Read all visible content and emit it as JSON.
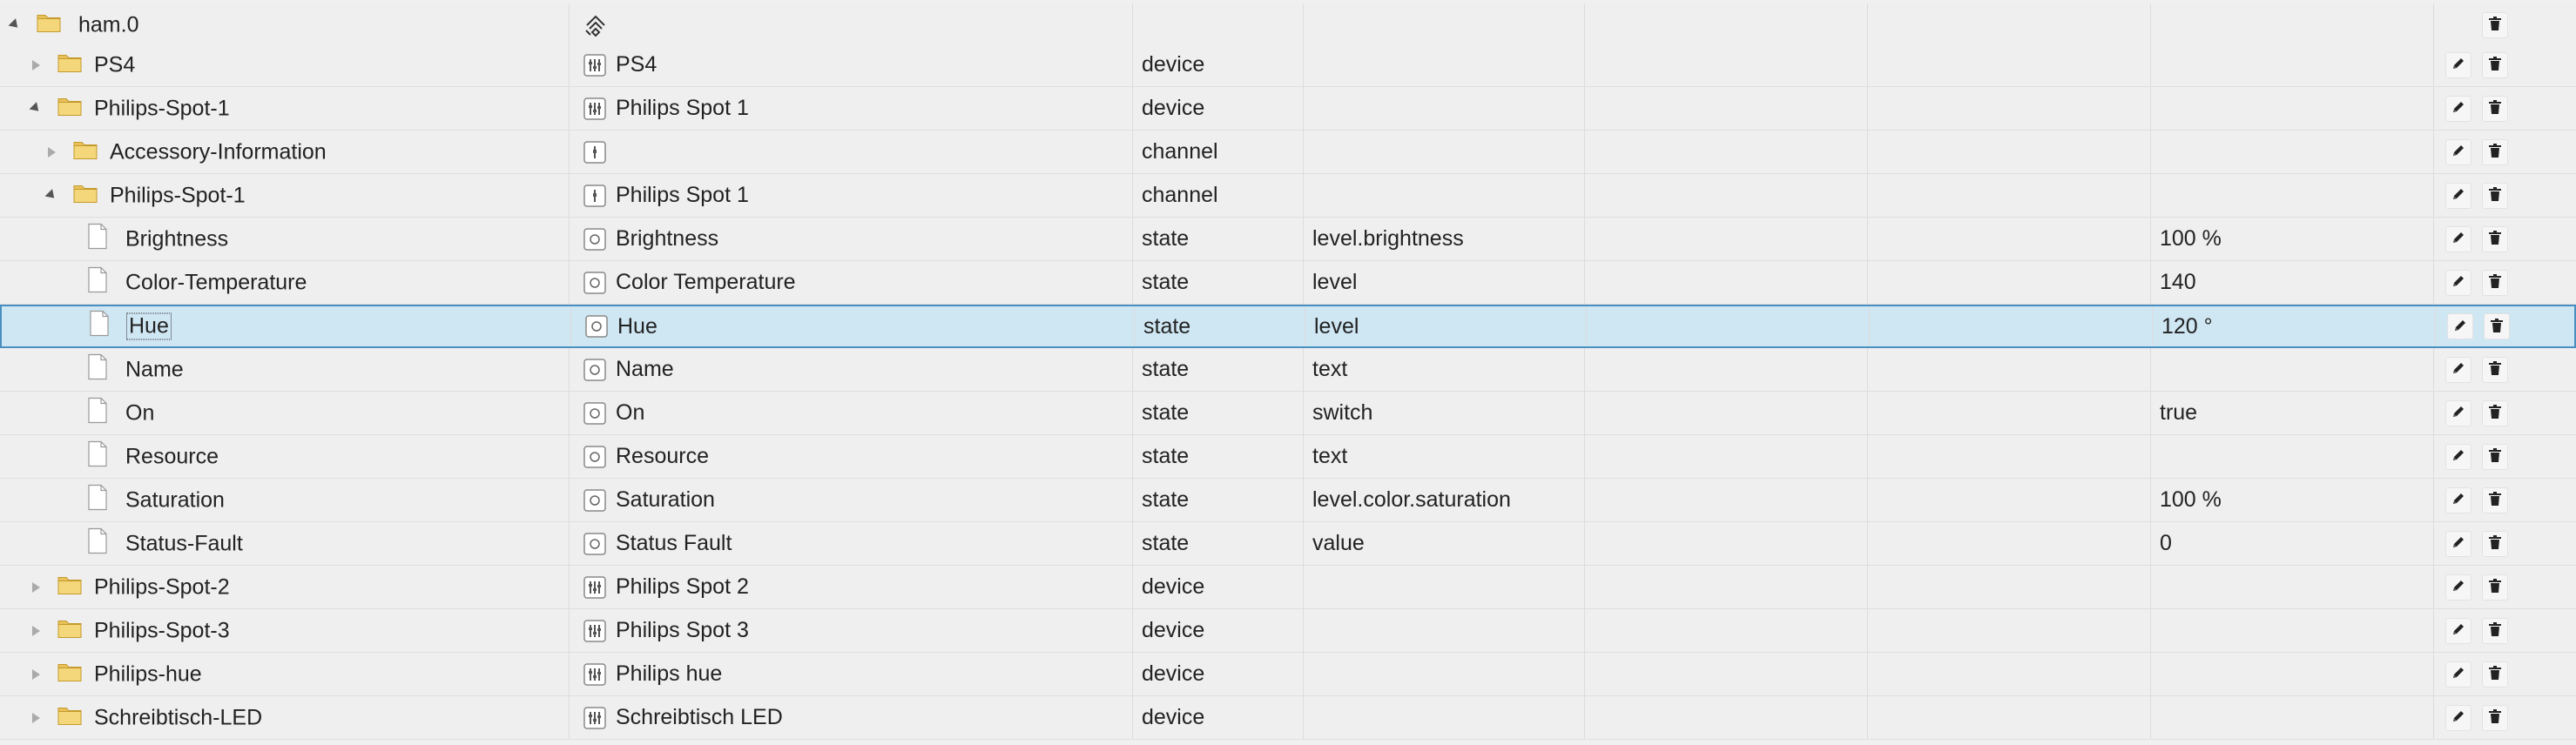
{
  "rows": [
    {
      "name": "ham.0",
      "level": 0,
      "expander": "expanded",
      "kind": "folder",
      "type_icon": "instance-icon",
      "display_name": "",
      "type": "",
      "role": "",
      "value": "",
      "editable": false,
      "selected": false
    },
    {
      "name": "PS4",
      "level": 1,
      "expander": "collapsed",
      "kind": "folder",
      "type_icon": "device-icon",
      "display_name": "PS4",
      "type": "device",
      "role": "",
      "value": "",
      "editable": true,
      "selected": false
    },
    {
      "name": "Philips-Spot-1",
      "level": 1,
      "expander": "expanded",
      "kind": "folder",
      "type_icon": "device-icon",
      "display_name": "Philips Spot 1",
      "type": "device",
      "role": "",
      "value": "",
      "editable": true,
      "selected": false
    },
    {
      "name": "Accessory-Information",
      "level": 2,
      "expander": "collapsed",
      "kind": "folder",
      "type_icon": "channel-icon",
      "display_name": "",
      "type": "channel",
      "role": "",
      "value": "",
      "editable": true,
      "selected": false
    },
    {
      "name": "Philips-Spot-1",
      "level": 2,
      "expander": "expanded",
      "kind": "folder",
      "type_icon": "channel-icon",
      "display_name": "Philips Spot 1",
      "type": "channel",
      "role": "",
      "value": "",
      "editable": true,
      "selected": false
    },
    {
      "name": "Brightness",
      "level": 3,
      "expander": "none",
      "kind": "file",
      "type_icon": "state-icon",
      "display_name": "Brightness",
      "type": "state",
      "role": "level.brightness",
      "value": "100 %",
      "editable": true,
      "selected": false
    },
    {
      "name": "Color-Temperature",
      "level": 3,
      "expander": "none",
      "kind": "file",
      "type_icon": "state-icon",
      "display_name": "Color Temperature",
      "type": "state",
      "role": "level",
      "value": "140",
      "editable": true,
      "selected": false
    },
    {
      "name": "Hue",
      "level": 3,
      "expander": "none",
      "kind": "file",
      "type_icon": "state-icon",
      "display_name": "Hue",
      "type": "state",
      "role": "level",
      "value": "120 °",
      "editable": true,
      "selected": true
    },
    {
      "name": "Name",
      "level": 3,
      "expander": "none",
      "kind": "file",
      "type_icon": "state-icon",
      "display_name": "Name",
      "type": "state",
      "role": "text",
      "value": "",
      "editable": true,
      "selected": false
    },
    {
      "name": "On",
      "level": 3,
      "expander": "none",
      "kind": "file",
      "type_icon": "state-icon",
      "display_name": "On",
      "type": "state",
      "role": "switch",
      "value": "true",
      "editable": true,
      "selected": false
    },
    {
      "name": "Resource",
      "level": 3,
      "expander": "none",
      "kind": "file",
      "type_icon": "state-icon",
      "display_name": "Resource",
      "type": "state",
      "role": "text",
      "value": "",
      "editable": true,
      "selected": false
    },
    {
      "name": "Saturation",
      "level": 3,
      "expander": "none",
      "kind": "file",
      "type_icon": "state-icon",
      "display_name": "Saturation",
      "type": "state",
      "role": "level.color.saturation",
      "value": "100 %",
      "editable": true,
      "selected": false
    },
    {
      "name": "Status-Fault",
      "level": 3,
      "expander": "none",
      "kind": "file",
      "type_icon": "state-icon",
      "display_name": "Status Fault",
      "type": "state",
      "role": "value",
      "value": "0",
      "editable": true,
      "selected": false
    },
    {
      "name": "Philips-Spot-2",
      "level": 1,
      "expander": "collapsed",
      "kind": "folder",
      "type_icon": "device-icon",
      "display_name": "Philips Spot 2",
      "type": "device",
      "role": "",
      "value": "",
      "editable": true,
      "selected": false
    },
    {
      "name": "Philips-Spot-3",
      "level": 1,
      "expander": "collapsed",
      "kind": "folder",
      "type_icon": "device-icon",
      "display_name": "Philips Spot 3",
      "type": "device",
      "role": "",
      "value": "",
      "editable": true,
      "selected": false
    },
    {
      "name": "Philips-hue",
      "level": 1,
      "expander": "collapsed",
      "kind": "folder",
      "type_icon": "device-icon",
      "display_name": "Philips hue",
      "type": "device",
      "role": "",
      "value": "",
      "editable": true,
      "selected": false
    },
    {
      "name": "Schreibtisch-LED",
      "level": 1,
      "expander": "collapsed",
      "kind": "folder",
      "type_icon": "device-icon",
      "display_name": "Schreibtisch LED",
      "type": "device",
      "role": "",
      "value": "",
      "editable": true,
      "selected": false
    }
  ],
  "actions": {
    "edit_icon": "pencil-icon",
    "delete_icon": "trash-icon"
  },
  "colors": {
    "selection_bg": "#cfe6f3",
    "selection_border": "#4a8fc2",
    "folder": "#e8c15a",
    "row_bg": "#efefef"
  }
}
